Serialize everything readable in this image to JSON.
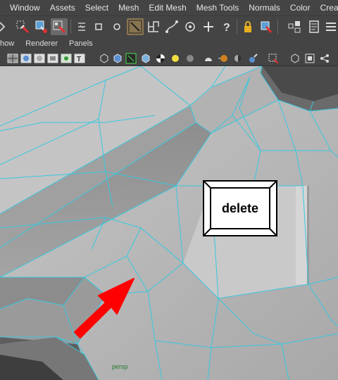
{
  "menubar": {
    "items": [
      "Window",
      "Assets",
      "Select",
      "Mesh",
      "Edit Mesh",
      "Mesh Tools",
      "Normals",
      "Color",
      "Create UVs"
    ]
  },
  "panel_menu": {
    "items": [
      "how",
      "Renderer",
      "Panels"
    ]
  },
  "shelf_icons": [
    "paint-select-icon",
    "lasso-icon",
    "select-object-icon",
    "paint-weights-icon",
    "cube-icon",
    "sphere-icon",
    "multicut-icon",
    "curve-tool-icon",
    "target-weld-icon",
    "move-icon",
    "help-icon",
    "lock-icon",
    "snap-icon",
    "uv-layout-icon",
    "notes-icon"
  ],
  "viewport": {
    "camera_label": "persp",
    "overlay_key_label": "delete",
    "arrow_color": "#ff0000",
    "wire_color": "#38c8e0"
  }
}
